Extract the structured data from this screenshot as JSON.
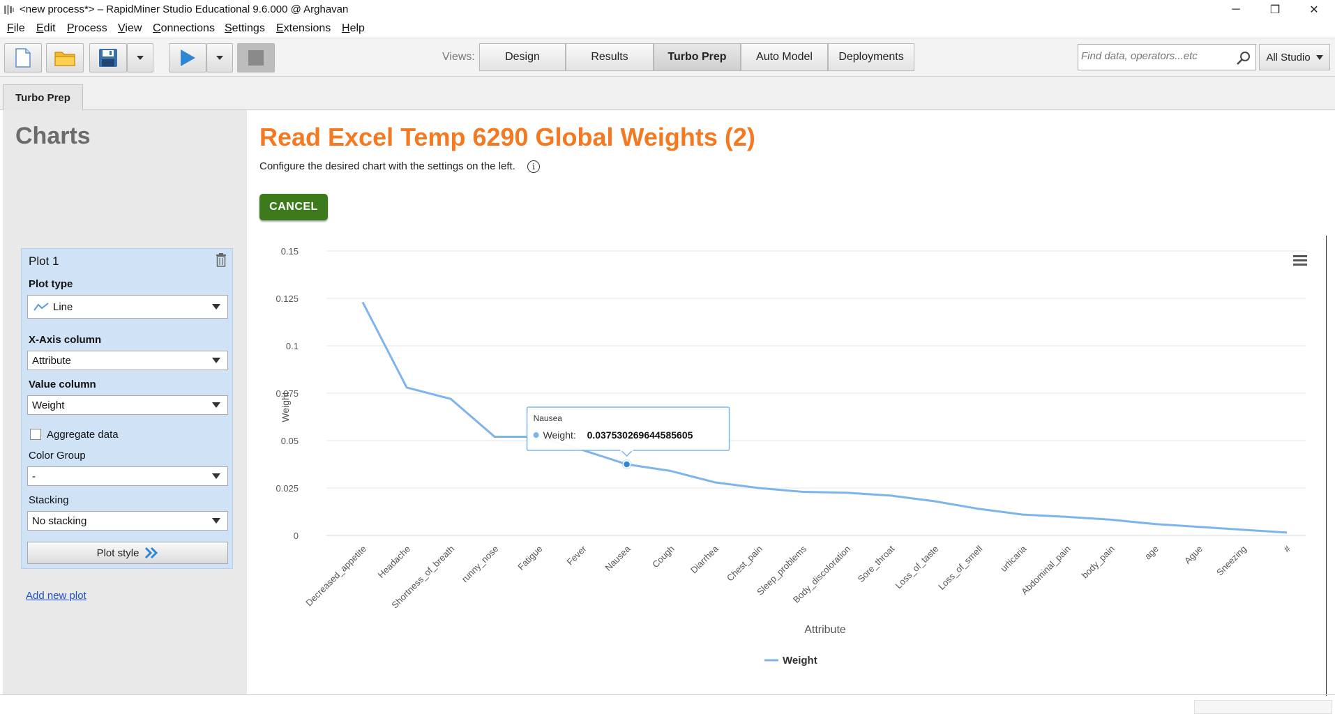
{
  "window": {
    "title": "<new process*> – RapidMiner Studio Educational 9.6.000 @ Arghavan",
    "minimize": "─",
    "restore": "❐",
    "close": "✕"
  },
  "menu": [
    "File",
    "Edit",
    "Process",
    "View",
    "Connections",
    "Settings",
    "Extensions",
    "Help"
  ],
  "toolbar": {
    "views_label": "Views:",
    "views": [
      {
        "label": "Design",
        "active": false
      },
      {
        "label": "Results",
        "active": false
      },
      {
        "label": "Turbo Prep",
        "active": true
      },
      {
        "label": "Auto Model",
        "active": false
      },
      {
        "label": "Deployments",
        "active": false
      }
    ],
    "search_placeholder": "Find data, operators...etc",
    "scope_label": "All Studio"
  },
  "tab": {
    "label": "Turbo Prep"
  },
  "left_panel": {
    "title": "Charts",
    "plot_name": "Plot 1",
    "plot_type_label": "Plot type",
    "plot_type_value": "Line",
    "x_axis_label": "X-Axis column",
    "x_axis_value": "Attribute",
    "value_column_label": "Value column",
    "value_column_value": "Weight",
    "aggregate_label": "Aggregate data",
    "color_group_label": "Color Group",
    "color_group_value": "-",
    "stacking_label": "Stacking",
    "stacking_value": "No stacking",
    "plot_style_label": "Plot style",
    "add_plot_label": "Add new plot"
  },
  "main": {
    "title": "Read Excel Temp 6290 Global Weights (2)",
    "subtitle": "Configure the desired chart with the settings on the left.",
    "cancel_label": "CANCEL"
  },
  "colors": {
    "accent_orange": "#f47920",
    "cancel_green": "#3d7a1c",
    "series_blue": "#7cb5ec",
    "panel_blue": "#cfe2f6"
  },
  "chart_data": {
    "type": "line",
    "xlabel": "Attribute",
    "ylabel": "Weight",
    "ylim": [
      0,
      0.15
    ],
    "yticks": [
      "0",
      "0.025",
      "0.05",
      "0.075",
      "0.1",
      "0.125",
      "0.15"
    ],
    "grid": true,
    "legend": "bottom-center",
    "categories": [
      "Decreased_appetite",
      "Headache",
      "Shortness_of_breath",
      "runny_nose",
      "Fatigue",
      "Fever",
      "Nausea",
      "Cough",
      "Diarrhea",
      "Chest_pain",
      "Sleep_problems",
      "Body_discoloration",
      "Sore_throat",
      "Loss_of_taste",
      "Loss_of_smell",
      "urticaria",
      "Abdominal_pain",
      "body_pain",
      "age",
      "Ague",
      "Sneezing",
      "#"
    ],
    "series": [
      {
        "name": "Weight",
        "values": [
          0.123,
          0.078,
          0.072,
          0.052,
          0.052,
          0.045,
          0.0375,
          0.034,
          0.028,
          0.025,
          0.023,
          0.0225,
          0.021,
          0.018,
          0.014,
          0.011,
          0.0098,
          0.0083,
          0.006,
          0.0045,
          0.003,
          0.0015
        ]
      }
    ],
    "tooltip": {
      "category": "Nausea",
      "series": "Weight",
      "value": "0.037530269644585605"
    }
  }
}
